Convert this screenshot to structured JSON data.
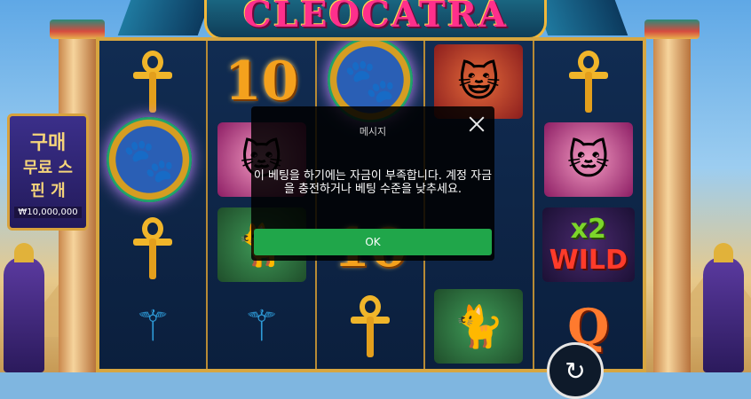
{
  "game": {
    "title": "CLEOCATRA"
  },
  "buy_feature": {
    "line1": "구매",
    "line2": "무료 스",
    "line3": "핀 개",
    "price": "₩10,000,000"
  },
  "reels": {
    "reel1": [
      "ankh-symbol",
      "paw-coin-symbol",
      "ankh-symbol",
      "crook-flail-symbol"
    ],
    "reel2": [
      "ten-symbol",
      "cleocatra-symbol",
      "sphynx-cat-symbol",
      "crook-flail-symbol"
    ],
    "reel3": [
      "paw-coin-symbol",
      "",
      "ten-symbol",
      "ankh-symbol"
    ],
    "reel4": [
      "pharaoh-cat-symbol",
      "",
      "",
      "sphynx-cat-symbol"
    ],
    "reel5": [
      "ankh-symbol",
      "cleocatra-symbol",
      "wild-x2-symbol",
      "q-symbol"
    ],
    "ten_label": "10",
    "q_label": "Q",
    "wild_multiplier": "x2",
    "wild_label": "WILD"
  },
  "dialog": {
    "title": "메시지",
    "message": "이 베팅을 하기에는 자금이 부족합니다. 계정 자금을 충전하거나 베팅 수준을 낮추세요.",
    "ok_label": "OK",
    "button_color": "#20a64a"
  },
  "icons": {
    "close": "close-icon",
    "spin": "spin-icon"
  }
}
